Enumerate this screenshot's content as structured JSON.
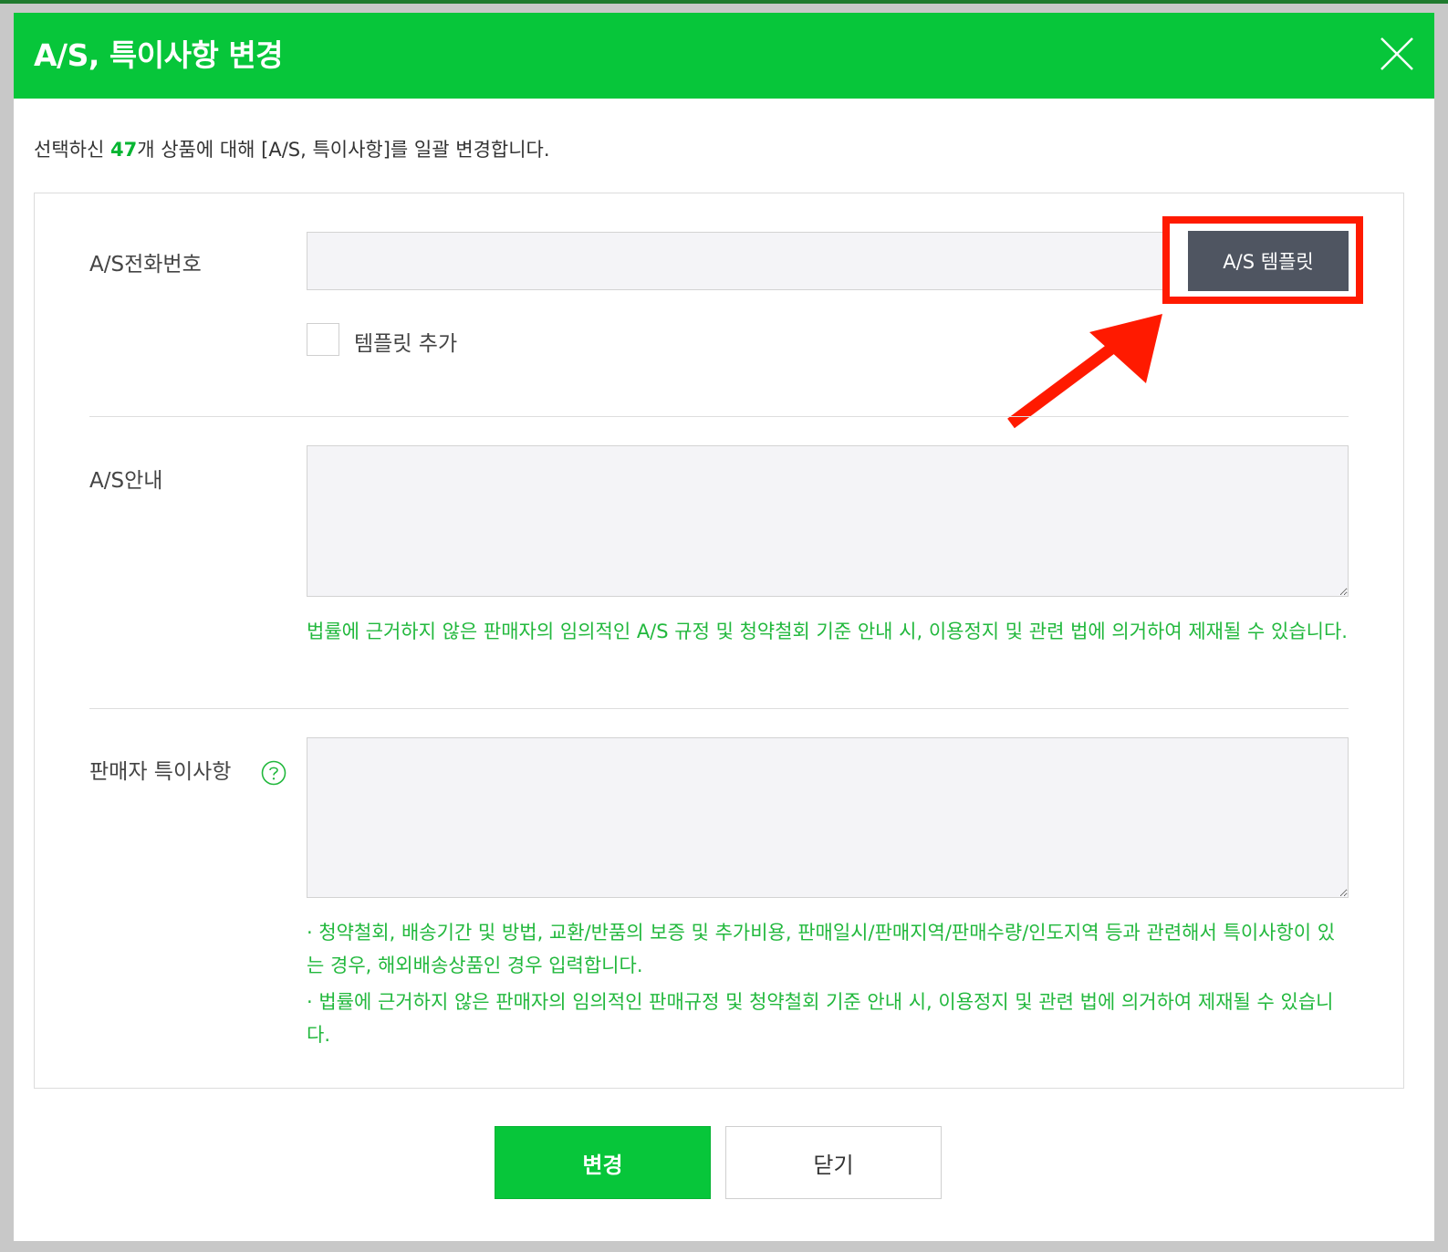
{
  "dialog": {
    "title": "A/S, 특이사항 변경",
    "close_icon": "close-icon",
    "intro_before": "선택하신 ",
    "selected_count": "47",
    "intro_after": "개 상품에 대해 [A/S, 특이사항]를 일괄 변경합니다."
  },
  "as_phone": {
    "label": "A/S전화번호",
    "value": "",
    "template_button": "A/S 템플릿",
    "add_template_label": "템플릿 추가",
    "add_template_checked": false
  },
  "as_info": {
    "label": "A/S안내",
    "value": "",
    "notice": "법률에 근거하지 않은 판매자의 임의적인 A/S 규정 및 청약철회 기준 안내 시, 이용정지 및 관련 법에 의거하여 제재될 수 있습니다."
  },
  "seller_notes": {
    "label": "판매자 특이사항",
    "help_icon": "question-circle-icon",
    "value": "",
    "notice_1": "· 청약철회, 배송기간 및 방법, 교환/반품의 보증 및 추가비용, 판매일시/판매지역/판매수량/인도지역 등과 관련해서 특이사항이 있는 경우, 해외배송상품인 경우 입력합니다.",
    "notice_2": "· 법률에 근거하지 않은 판매자의 임의적인 판매규정 및 청약철회 기준 안내 시, 이용정지 및 관련 법에 의거하여 제재될 수 있습니다."
  },
  "footer": {
    "confirm_label": "변경",
    "close_label": "닫기"
  },
  "colors": {
    "brand_green": "#07c63a",
    "template_button_bg": "#4f5561",
    "notice_green": "#22b83d",
    "highlight_red": "#ff1a00"
  }
}
